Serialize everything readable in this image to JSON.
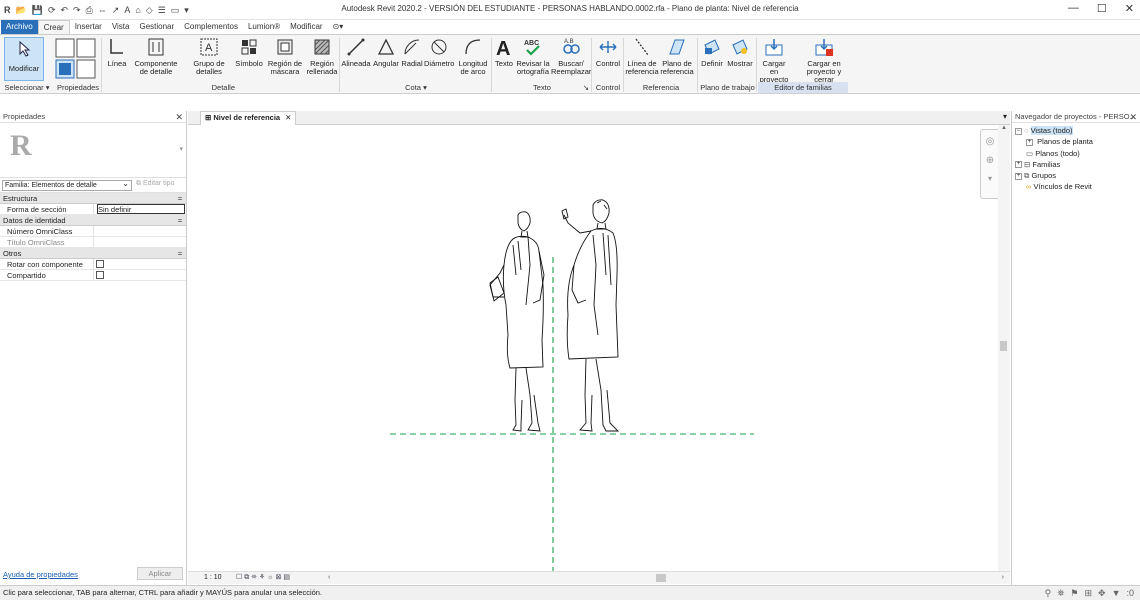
{
  "window": {
    "title": "Autodesk Revit 2020.2 - VERSIÓN DEL ESTUDIANTE - PERSONAS HABLANDO.0002.rfa - Plano de planta: Nivel de referencia"
  },
  "tabs": [
    "Archivo",
    "Crear",
    "Insertar",
    "Vista",
    "Gestionar",
    "Complementos",
    "Lumion®",
    "Modificar"
  ],
  "ribbon": {
    "modify": "Modificar",
    "buttons": {
      "linea": "Línea",
      "componente": "Componente de detalle",
      "grupo": "Grupo de detalles",
      "simbolo": "Símbolo",
      "region_mascara": "Región de máscara",
      "region_rellenada": "Región rellenada",
      "alineada": "Alineada",
      "angular": "Angular",
      "radial": "Radial",
      "diametro": "Diámetro",
      "longitud": "Longitud de arco",
      "texto": "Texto",
      "revisar": "Revisar la ortografía",
      "buscar": "Buscar/ Reemplazar",
      "control": "Control",
      "linea_ref": "Línea de referencia",
      "plano_ref": "Plano de referencia",
      "definir": "Definir",
      "mostrar": "Mostrar",
      "cargar": "Cargar en proyecto",
      "cargar_cerrar": "Cargar en proyecto y cerrar"
    },
    "groups": {
      "seleccionar": "Seleccionar",
      "propiedades": "Propiedades",
      "detalle": "Detalle",
      "cota": "Cota",
      "texto": "Texto",
      "control": "Control",
      "referencia": "Referencia",
      "plano_trabajo": "Plano de trabajo",
      "editor": "Editor de familias"
    }
  },
  "properties": {
    "title": "Propiedades",
    "family": "Familia: Elementos de detalle",
    "edit_type": "Editar tipo",
    "sections": {
      "estructura": "Estructura",
      "identidad": "Datos de identidad",
      "otros": "Otros"
    },
    "rows": {
      "forma_label": "Forma de sección",
      "forma_value": "Sin definir",
      "omni_num": "Número OmniClass",
      "omni_tit": "Título OmniClass",
      "rotar": "Rotar con componente",
      "compartido": "Compartido"
    },
    "help": "Ayuda de propiedades",
    "apply": "Aplicar"
  },
  "view": {
    "tab": "Nivel de referencia",
    "scale": "1 : 10"
  },
  "browser": {
    "title": "Navegador de proyectos - PERSO...",
    "items": [
      "Vistas (todo)",
      "Planos de planta",
      "Planos (todo)",
      "Familias",
      "Grupos",
      "Vínculos de Revit"
    ]
  },
  "status": {
    "text": "Clic para seleccionar, TAB para alternar, CTRL para añadir y MAYÚS para anular una selección.",
    "right": ":0"
  },
  "colors": {
    "accent": "#2a6fba",
    "ref_line": "#1aa34a",
    "family_editor": "#d8e1ef"
  }
}
